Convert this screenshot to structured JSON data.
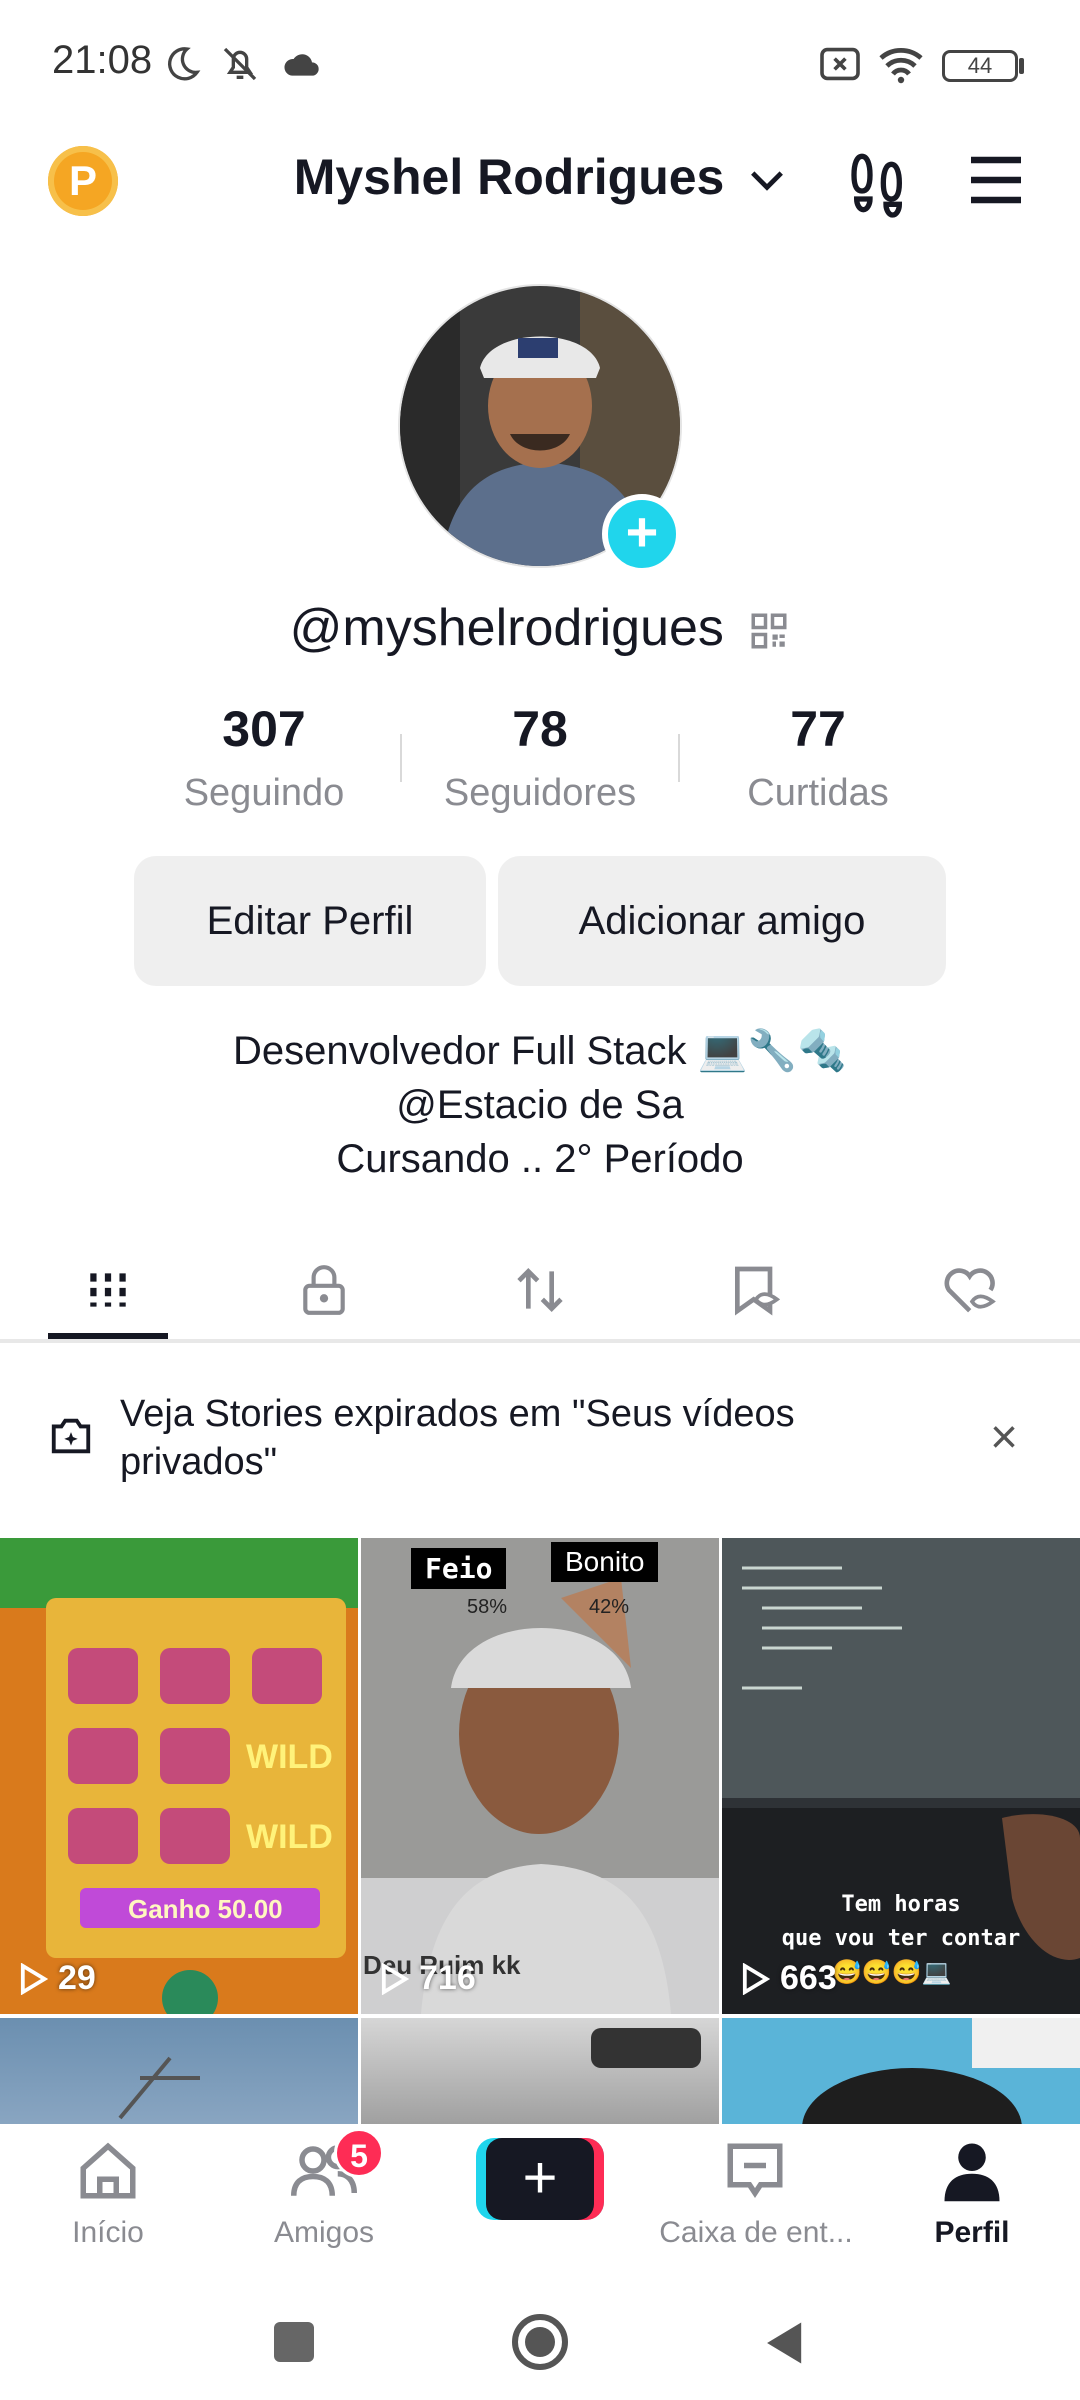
{
  "status_bar": {
    "time": "21:08",
    "battery": "44"
  },
  "header": {
    "points_badge": "P",
    "title": "Myshel Rodrigues"
  },
  "profile": {
    "username": "@myshelrodrigues",
    "stats": [
      {
        "value": "307",
        "label": "Seguindo"
      },
      {
        "value": "78",
        "label": "Seguidores"
      },
      {
        "value": "77",
        "label": "Curtidas"
      }
    ],
    "buttons": {
      "edit": "Editar Perfil",
      "add_friend": "Adicionar amigo"
    },
    "bio": [
      "Desenvolvedor Full Stack 💻🔧🔩",
      "@Estacio de Sa",
      "Cursando .. 2° Período"
    ]
  },
  "tabs": [
    "videos-grid",
    "private-lock",
    "reposts",
    "favorites",
    "liked"
  ],
  "banner": {
    "text": "Veja Stories expirados em \"Seus vídeos privados\"",
    "close": "×"
  },
  "videos": [
    {
      "views": "29",
      "overlay": [
        "Ganho 50.00",
        "WILD",
        "WILD"
      ]
    },
    {
      "views": "716",
      "overlay": [
        "Feio",
        "Bonito",
        "58%",
        "42%",
        "Deu Ruim kk"
      ]
    },
    {
      "views": "663",
      "overlay": [
        "Tem horas",
        "que vou ter contar",
        "😅😅😅💻"
      ]
    }
  ],
  "bottom_nav": [
    {
      "label": "Início",
      "active": false
    },
    {
      "label": "Amigos",
      "active": false,
      "badge": "5"
    },
    {
      "label": "",
      "active": false
    },
    {
      "label": "Caixa de ent...",
      "active": false
    },
    {
      "label": "Perfil",
      "active": true
    }
  ],
  "colors": {
    "accent": "#20d5ec",
    "badge": "#fe2c55",
    "points": "#f5a623"
  }
}
